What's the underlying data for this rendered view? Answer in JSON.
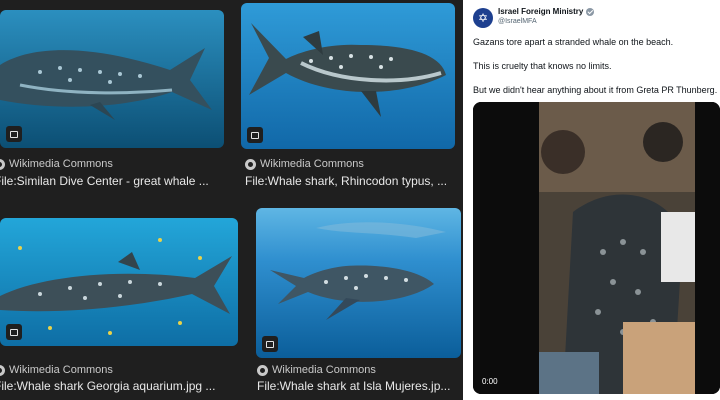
{
  "results": [
    {
      "source": "Wikimedia Commons",
      "title": "File:Similan Dive Center - great whale ..."
    },
    {
      "source": "Wikimedia Commons",
      "title": "File:Whale shark, Rhincodon typus, ..."
    },
    {
      "source": "Wikimedia Commons",
      "title": "File:Whale shark Georgia aquarium.jpg ..."
    },
    {
      "source": "Wikimedia Commons",
      "title": "File:Whale shark at Isla Mujeres.jp..."
    }
  ],
  "tweet": {
    "name": "Israel Foreign Ministry",
    "handle": "@IsraelMFA",
    "lines": [
      "Gazans tore apart a stranded whale on the beach.",
      "This is cruelty that knows no limits.",
      "But we didn't hear anything about it from Greta PR Thunberg."
    ],
    "video_time": "0:00"
  },
  "colors": {
    "page_bg": "#1f1f1f",
    "ocean": "#0b6fa8",
    "tweet_bg": "#ffffff",
    "avatar": "#1d3f8f"
  },
  "icons": [
    "image-badge-icon",
    "wikimedia-logo-icon",
    "verified-badge-icon"
  ]
}
